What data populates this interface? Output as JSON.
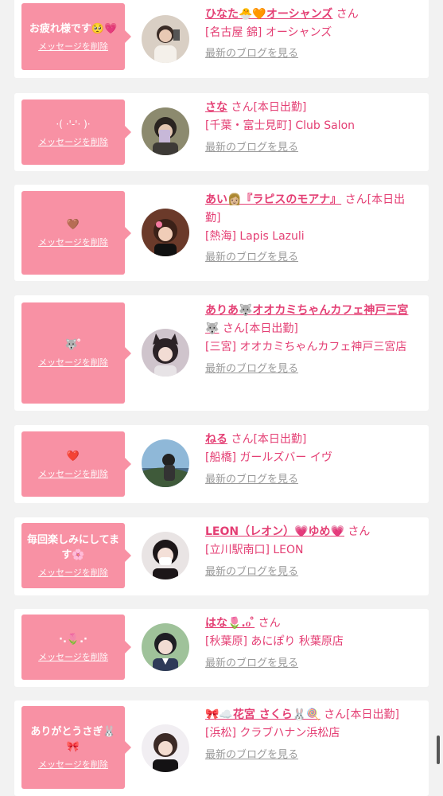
{
  "common": {
    "delete_label": "メッセージを削除",
    "blog_label": "最新のブログを見る"
  },
  "colors": {
    "bubble": "#f891a4",
    "accent": "#e43f74",
    "muted": "#9a9a9a"
  },
  "cards": [
    {
      "message": "お疲れ様です🥺💗",
      "name": "ひなた🐣🧡オーシャンズ",
      "san": "さん",
      "shop": "[名古屋 錦] オーシャンズ"
    },
    {
      "message": "·( ·'-'· )·",
      "name": "さな",
      "san": "さん[本日出勤]",
      "shop": "[千葉・富士見町] Club Salon"
    },
    {
      "message": "🤎",
      "name": "あい👩🏼『ラピスのモアナ』",
      "san": "さん[本日出勤]",
      "shop": "[熱海] Lapis Lazuli"
    },
    {
      "message": "🐺 ̊",
      "name": "ありあ🐺オオカミちゃんカフェ神戸三宮🐺",
      "san": "さん[本日出勤]",
      "shop": "[三宮] オオカミちゃんカフェ神戸三宮店"
    },
    {
      "message": "❤️",
      "name": "ねる",
      "san": "さん[本日出勤]",
      "shop": "[船橋] ガールズバー イヴ"
    },
    {
      "message": "毎回楽しみにしてます🌸",
      "name": "LEON（レオン）💗ゆめ💗",
      "san": "さん",
      "shop": "[立川駅南口] LEON"
    },
    {
      "message": "·.🌷.·",
      "name": "はな🌷.ℴ ̊",
      "san": "さん",
      "shop": "[秋葉原] あにぽり 秋葉原店"
    },
    {
      "message": "ありがとうさぎ🐰🎀",
      "name": "🎀☁️花宮 さくら🐰🍭",
      "san": "さん[本日出勤]",
      "shop": "[浜松] クラブハナン浜松店"
    }
  ]
}
